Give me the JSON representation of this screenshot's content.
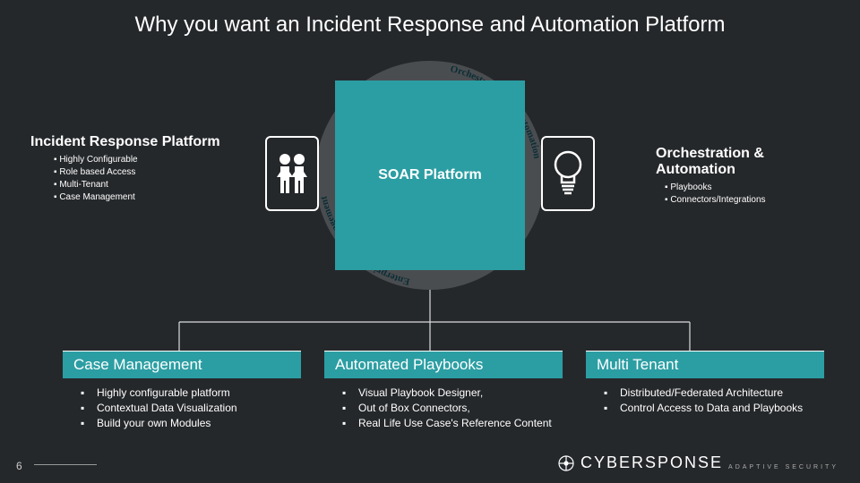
{
  "title": "Why you want an Incident Response and Automation Platform",
  "left": {
    "heading": "Incident Response Platform",
    "items": [
      "Highly Configurable",
      "Role based Access",
      "Multi-Tenant",
      "Case Management"
    ]
  },
  "right": {
    "heading": "Orchestration & Automation",
    "items": [
      "Playbooks",
      "Connectors/Integrations"
    ]
  },
  "center": {
    "label": "SOAR Platform",
    "ring_text_left": "Enterprise Case Management",
    "ring_text_right": "Orchestration and Automation"
  },
  "cards": [
    {
      "title": "Case Management",
      "items": [
        "Highly configurable platform",
        "Contextual Data Visualization",
        "Build your own Modules"
      ]
    },
    {
      "title": "Automated Playbooks",
      "items": [
        "Visual Playbook Designer,",
        "Out of Box Connectors,",
        "Real Life Use Case's Reference Content"
      ]
    },
    {
      "title": "Multi Tenant",
      "items": [
        "Distributed/Federated Architecture",
        "Control Access to Data and Playbooks"
      ]
    }
  ],
  "page_number": "6",
  "logo": {
    "main": "CYBERSPONSE",
    "sub": "ADAPTIVE SECURITY"
  },
  "colors": {
    "accent": "#2b9ea3",
    "bg": "#25282b"
  }
}
